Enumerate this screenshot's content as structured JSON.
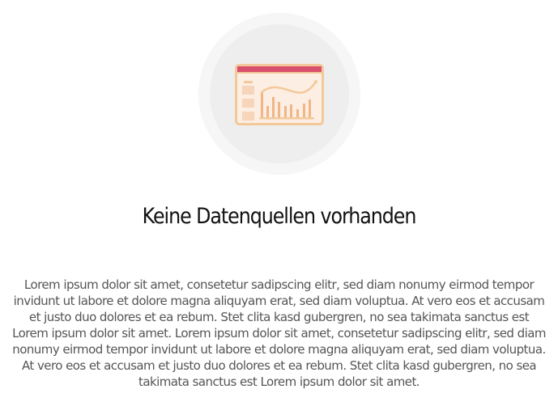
{
  "empty_state": {
    "icon": "dashboard-chart-icon",
    "title": "Keine Datenquellen vorhanden",
    "description": "Lorem ipsum dolor sit amet, consetetur sadipscing elitr, sed diam nonumy eirmod tempor invidunt ut labore et dolore magna aliquyam erat, sed diam voluptua. At vero eos et accusam et justo duo dolores et ea rebum. Stet clita kasd gubergren, no sea takimata sanctus est Lorem ipsum dolor sit amet. Lorem ipsum dolor sit amet, consetetur sadipscing elitr, sed diam nonumy eirmod tempor invidunt ut labore et dolore magna aliquyam erat, sed diam voluptua. At vero eos et accusam et justo duo dolores et ea rebum. Stet clita kasd gubergren, no sea takimata sanctus est Lorem ipsum dolor sit amet."
  },
  "colors": {
    "accent_header": "#d9506e",
    "accent_frame": "#f2c99a",
    "illustration_fill": "#fdeee3",
    "title": "#111111",
    "description": "#555555"
  }
}
